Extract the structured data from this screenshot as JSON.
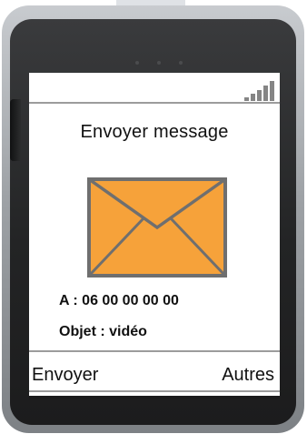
{
  "screen": {
    "title": "Envoyer message",
    "recipient_line": "A : 06 00 00 00 00",
    "subject_line": "Objet : vidéo",
    "softkeys": {
      "left": "Envoyer",
      "right": "Autres"
    },
    "status": {
      "signal_icon": "signal-strength-icon",
      "signal_bars": 5
    },
    "envelope_icon": "envelope-icon"
  },
  "colors": {
    "envelope_fill": "#f6a23a",
    "envelope_stroke": "#6f6f6f",
    "phone_frame": "#2a2b2c",
    "screen_bg": "#ffffff"
  }
}
